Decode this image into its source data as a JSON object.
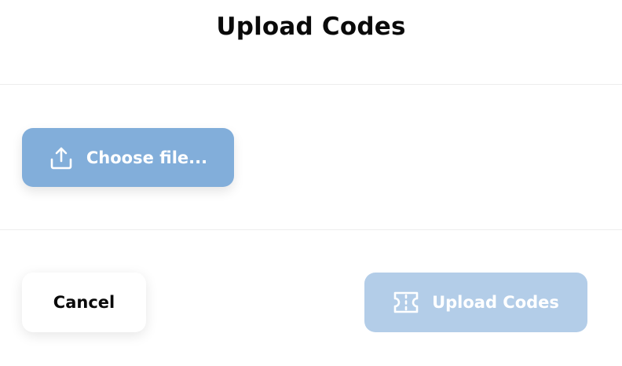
{
  "modal": {
    "title": "Upload Codes"
  },
  "file_picker": {
    "label": "Choose file...",
    "icon": "upload-icon"
  },
  "footer": {
    "cancel_label": "Cancel",
    "submit_label": "Upload Codes",
    "submit_icon": "ticket-icon",
    "submit_disabled": true
  },
  "colors": {
    "choose_button_bg": "#82aeda",
    "submit_button_bg": "#b3cde8",
    "divider": "#ededed",
    "text_dark": "#0a0a0a"
  }
}
